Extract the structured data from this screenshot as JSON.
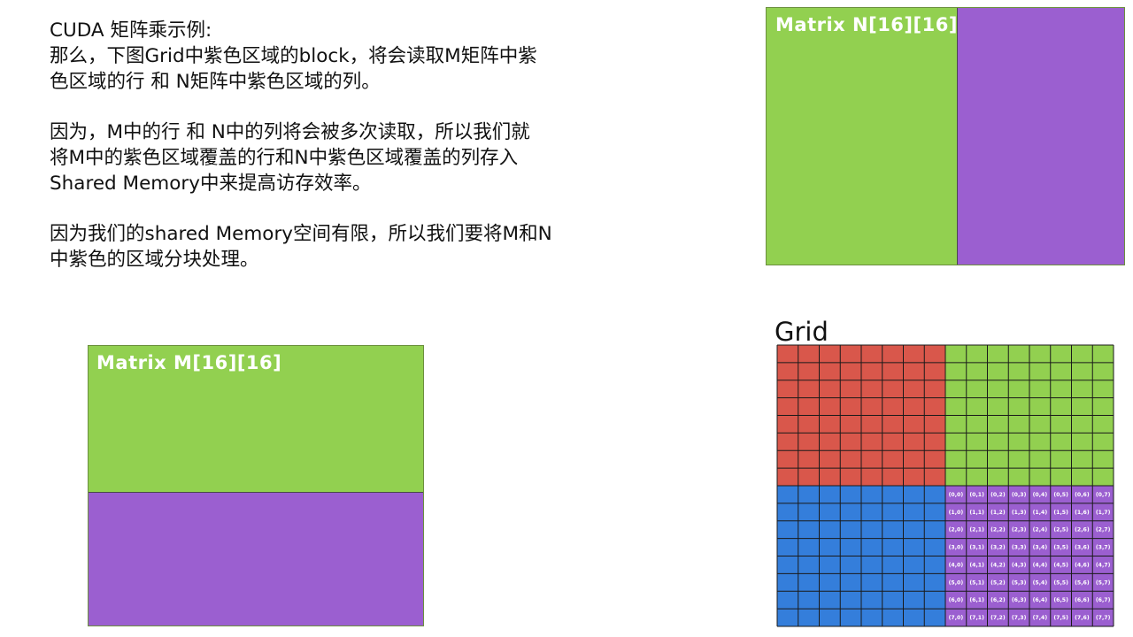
{
  "intro": {
    "p1": "CUDA 矩阵乘示例:\n那么，下图Grid中紫色区域的block，将会读取M矩阵中紫\n色区域的行 和 N矩阵中紫色区域的列。",
    "p2": "因为，M中的行 和 N中的列将会被多次读取，所以我们就\n将M中的紫色区域覆盖的行和N中紫色区域覆盖的列存入\nShared Memory中来提高访存效率。",
    "p3": "因为我们的shared Memory空间有限，所以我们要将M和N\n中紫色的区域分块处理。"
  },
  "matrix_n": {
    "title": "Matrix N[16][16]"
  },
  "matrix_m": {
    "title": "Matrix M[16][16]"
  },
  "grid": {
    "title": "Grid",
    "rows": 16,
    "cols": 16,
    "block_labels": [
      [
        "(0,0)",
        "(0,1)",
        "(0,2)",
        "(0,3)",
        "(0,4)",
        "(0,5)",
        "(0,6)",
        "(0,7)"
      ],
      [
        "(1,0)",
        "(1,1)",
        "(1,2)",
        "(1,3)",
        "(1,4)",
        "(1,5)",
        "(1,6)",
        "(1,7)"
      ],
      [
        "(2,0)",
        "(2,1)",
        "(2,2)",
        "(2,3)",
        "(2,4)",
        "(2,5)",
        "(2,6)",
        "(2,7)"
      ],
      [
        "(3,0)",
        "(3,1)",
        "(3,2)",
        "(3,3)",
        "(3,4)",
        "(3,5)",
        "(3,6)",
        "(3,7)"
      ],
      [
        "(4,0)",
        "(4,1)",
        "(4,2)",
        "(4,3)",
        "(4,4)",
        "(4,5)",
        "(4,6)",
        "(4,7)"
      ],
      [
        "(5,0)",
        "(5,1)",
        "(5,2)",
        "(5,3)",
        "(5,4)",
        "(5,5)",
        "(5,6)",
        "(5,7)"
      ],
      [
        "(6,0)",
        "(6,1)",
        "(6,2)",
        "(6,3)",
        "(6,4)",
        "(6,5)",
        "(6,6)",
        "(6,7)"
      ],
      [
        "(7,0)",
        "(7,1)",
        "(7,2)",
        "(7,3)",
        "(7,4)",
        "(7,5)",
        "(7,6)",
        "(7,7)"
      ]
    ]
  },
  "colors": {
    "green": "#92d050",
    "purple": "#9b5fd0",
    "red": "#d9574b",
    "blue": "#347edb",
    "gridline": "#1a1a1a"
  }
}
